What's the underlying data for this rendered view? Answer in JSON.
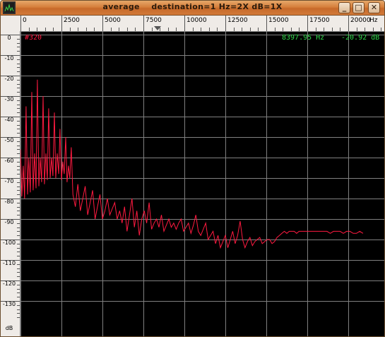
{
  "window": {
    "title": "average    destination=1 Hz=2X dB=1X",
    "minimize_glyph": "_",
    "maximize_glyph": "□",
    "close_glyph": "✕"
  },
  "x_axis": {
    "ticks": [
      "0",
      "2500",
      "5000",
      "7500",
      "10000",
      "12500",
      "15000",
      "17500",
      "20000"
    ],
    "unit": "Hz"
  },
  "y_axis": {
    "ticks": [
      "0",
      "-10",
      "-20",
      "-30",
      "-40",
      "-50",
      "-60",
      "-70",
      "-80",
      "-90",
      "-100",
      "-110",
      "-120",
      "-130"
    ],
    "unit": "dB"
  },
  "display": {
    "trace_label": "#320",
    "cursor_frequency": "8397.95 Hz",
    "cursor_level": "-20.92 dB",
    "trace_color": "#ff1a40",
    "readout_color": "#2fd84a",
    "background_color": "#000000",
    "grid_color": "#808080"
  },
  "chart_data": {
    "type": "line",
    "title": "",
    "xlabel": "Hz",
    "ylabel": "dB",
    "xlim": [
      0,
      21700
    ],
    "ylim": [
      -135,
      0
    ],
    "grid": true,
    "series": [
      {
        "values_x": [
          0,
          80,
          170,
          250,
          340,
          430,
          510,
          600,
          690,
          770,
          860,
          950,
          1030,
          1120,
          1200,
          1290,
          1380,
          1460,
          1550,
          1640,
          1720,
          1810,
          1900,
          1980,
          2070,
          2150,
          2240,
          2330,
          2410,
          2500,
          2580,
          2670,
          2760,
          2840,
          2930,
          3010,
          3100,
          3200,
          3350,
          3500,
          3650,
          3800,
          3950,
          4100,
          4250,
          4400,
          4550,
          4700,
          4850,
          5000,
          5150,
          5300,
          5450,
          5600,
          5750,
          5900,
          6050,
          6200,
          6350,
          6500,
          6650,
          6800,
          6950,
          7100,
          7250,
          7400,
          7550,
          7700,
          7850,
          8000,
          8150,
          8300,
          8450,
          8600,
          8750,
          8900,
          9050,
          9200,
          9350,
          9500,
          9650,
          9800,
          9950,
          10100,
          10250,
          10400,
          10550,
          10700,
          10850,
          11000,
          11150,
          11300,
          11450,
          11600,
          11750,
          11900,
          12050,
          12200,
          12350,
          12500,
          12650,
          12800,
          12950,
          13100,
          13250,
          13400,
          13550,
          13700,
          13850,
          14000,
          14150,
          14300,
          14450,
          14600,
          14750,
          14900,
          15050,
          15200,
          15350,
          15500,
          15650,
          15800,
          15950,
          16100,
          16250,
          16400,
          16550,
          16700,
          16850,
          17000,
          17150,
          17300,
          17500,
          17700,
          17900,
          18100,
          18300,
          18500,
          18700,
          18900,
          19100,
          19300,
          19500,
          19700,
          19900,
          20100,
          20300,
          20500,
          20700,
          20900,
          21100,
          21300,
          21500,
          21700
        ],
        "values_y": [
          -56,
          -79,
          -64,
          -80,
          -35,
          -78,
          -60,
          -77,
          -28,
          -76,
          -58,
          -75,
          -22,
          -74,
          -60,
          -72,
          -30,
          -73,
          -58,
          -71,
          -36,
          -70,
          -60,
          -69,
          -38,
          -70,
          -58,
          -68,
          -46,
          -71,
          -62,
          -68,
          -50,
          -72,
          -64,
          -70,
          -55,
          -78,
          -84,
          -73,
          -86,
          -80,
          -74,
          -88,
          -82,
          -76,
          -90,
          -84,
          -78,
          -90,
          -86,
          -80,
          -88,
          -85,
          -82,
          -90,
          -86,
          -92,
          -84,
          -96,
          -88,
          -80,
          -94,
          -86,
          -98,
          -90,
          -86,
          -92,
          -82,
          -95,
          -92,
          -90,
          -94,
          -88,
          -96,
          -93,
          -90,
          -94,
          -92,
          -95,
          -92,
          -90,
          -96,
          -94,
          -92,
          -97,
          -93,
          -88,
          -96,
          -98,
          -95,
          -92,
          -100,
          -98,
          -96,
          -102,
          -98,
          -104,
          -101,
          -98,
          -104,
          -100,
          -96,
          -102,
          -98,
          -91,
          -100,
          -104,
          -101,
          -99,
          -103,
          -101,
          -100,
          -99,
          -102,
          -101,
          -100,
          -100,
          -102,
          -101,
          -99,
          -98,
          -97,
          -96,
          -97,
          -96,
          -96,
          -96,
          -97,
          -96,
          -96,
          -96,
          -96,
          -96,
          -96,
          -96,
          -96,
          -96,
          -96,
          -97,
          -96,
          -96,
          -96,
          -97,
          -96,
          -96,
          -97,
          -97,
          -96,
          -97
        ]
      }
    ]
  }
}
